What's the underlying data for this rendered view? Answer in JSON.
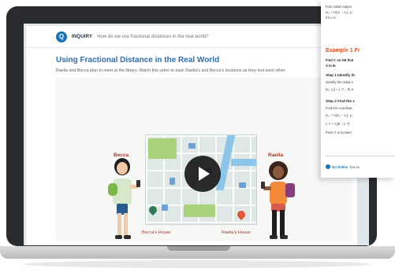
{
  "inquiry": {
    "logo_text": "Q",
    "label": "INQUIRY",
    "question": "How do we use fractional distances in the real world?"
  },
  "lesson": {
    "title": "Using Fractional Distance in the Real World",
    "description": "Raelia and Becca plan to meet at the library. Watch this video to track Raelia's and Becca's locations as they text each other."
  },
  "video": {
    "characters": {
      "left_name": "Becca",
      "right_name": "Raelia"
    },
    "houses": {
      "left_label": "Becca's House",
      "right_label": "Raelia's House"
    }
  },
  "document": {
    "top_lines": [
      "from initial endpoi",
      "(x₁ + ᵃ⁄ᵦ(x₂ − x₁), y₁",
      "if b ≠ 0."
    ],
    "example_title": "Example 1  Fr",
    "prompt_lines": [
      "Find C on AB that",
      "A to B."
    ],
    "step1_title": "Step 1  Identify th",
    "step1_lines": [
      "Identify the initial a",
      "(x₁, y₁) = (−7, −5) a"
    ],
    "step2_title": "Step 2  Find the x",
    "step2_lines": [
      "Find the coordinat",
      "(x₁ + ᵃ⁄ᵦ(x₂ − x₁), y₁",
      "(−7 + ²⁄₅[6 − (−7)",
      "Point C is located"
    ],
    "go_online": {
      "label": "Go Online",
      "text": "You ca"
    }
  },
  "colors": {
    "bezel": "#2a2b2e",
    "title_blue": "#2d6fb4",
    "accent_orange": "#d9582c",
    "name_red": "#a43a2d"
  }
}
